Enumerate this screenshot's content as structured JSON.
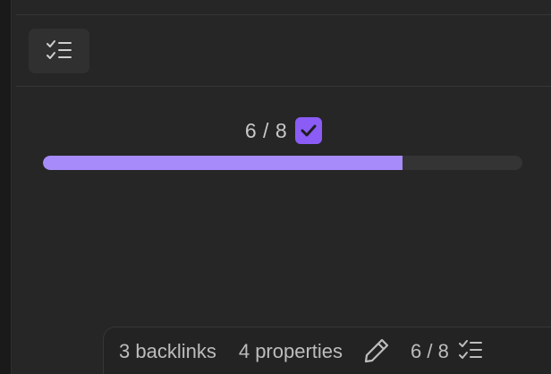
{
  "progress": {
    "completed": 6,
    "total": 8,
    "label": "6 / 8",
    "fraction": 0.75,
    "fill_color": "#a78bfa",
    "track_color": "#343434",
    "badge_color": "#8b5cf6"
  },
  "toolbar": {
    "task_list_icon": "checklist-icon"
  },
  "status_bar": {
    "backlinks": "3 backlinks",
    "properties": "4 properties",
    "edit_icon": "pencil-icon",
    "tasks_count": "6 / 8",
    "tasks_icon": "checklist-icon"
  }
}
